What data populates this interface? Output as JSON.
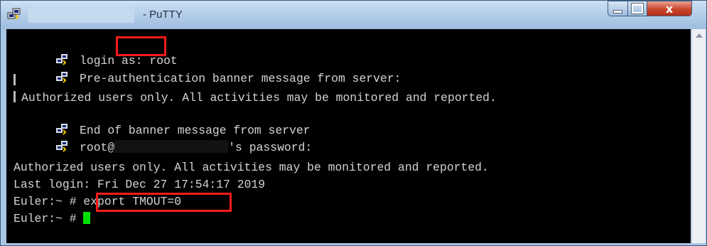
{
  "window": {
    "title": "- PuTTY",
    "close_label": "x"
  },
  "terminal": {
    "lines": [
      {
        "text": "login as: ",
        "value": "root"
      },
      {
        "text": "Pre-authentication banner message from server:"
      },
      {
        "text": "Authorized users only. All activities may be monitored and reported."
      },
      {
        "text": "End of banner message from server"
      },
      {
        "prefix": "root@",
        "suffix": "'s password:"
      },
      {
        "text": "Authorized users only. All activities may be monitored and reported."
      },
      {
        "text": "Last login: Fri Dec 27 17:54:17 2019"
      },
      {
        "prompt": "Euler:~ # ",
        "command": "export TMOUT=0"
      },
      {
        "prompt": "Euler:~ # "
      }
    ]
  },
  "colors": {
    "highlight": "#ff1a1a",
    "cursor": "#00e000",
    "background": "#000000",
    "text": "#d4d4d4"
  },
  "icons": [
    "putty-icon",
    "minimize-icon",
    "maximize-icon",
    "close-icon",
    "scroll-up-icon"
  ]
}
